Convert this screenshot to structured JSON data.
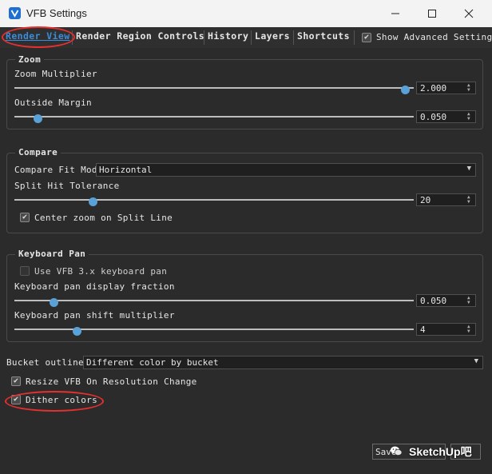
{
  "window": {
    "title": "VFB Settings"
  },
  "tabs": [
    {
      "label": "Render View"
    },
    {
      "label": "Render Region Controls"
    },
    {
      "label": "History"
    },
    {
      "label": "Layers"
    },
    {
      "label": "Shortcuts"
    }
  ],
  "show_advanced": {
    "label": "Show Advanced Settings",
    "checked": true
  },
  "zoom": {
    "title": "Zoom",
    "multiplier": {
      "label": "Zoom Multiplier",
      "value": "2.000",
      "fraction": 0.99
    },
    "outside_margin": {
      "label": "Outside Margin",
      "value": "0.050",
      "fraction": 0.05
    }
  },
  "compare": {
    "title": "Compare",
    "fit_mode": {
      "label": "Compare Fit Mode",
      "value": "Horizontal"
    },
    "split_hit": {
      "label": "Split Hit Tolerance",
      "value": "20",
      "fraction": 0.19
    },
    "center_zoom": {
      "label": "Center zoom on Split Line",
      "checked": true
    }
  },
  "keyboard_pan": {
    "title": "Keyboard Pan",
    "use_vfb3": {
      "label": "Use VFB 3.x keyboard pan",
      "checked": false
    },
    "display_fraction": {
      "label": "Keyboard pan display fraction",
      "value": "0.050",
      "fraction": 0.09
    },
    "shift_multiplier": {
      "label": "Keyboard pan shift multiplier",
      "value": "4",
      "fraction": 0.15
    }
  },
  "bucket_outlines": {
    "label": "Bucket outlines",
    "value": "Different color by bucket"
  },
  "resize_vfb": {
    "label": "Resize VFB On Resolution Change",
    "checked": true
  },
  "dither_colors": {
    "label": "Dither colors",
    "checked": true
  },
  "footer": {
    "save_label": "Save",
    "watermark": "SketchUp吧"
  },
  "colors": {
    "accent": "#3a8ddd",
    "knob": "#5aa1d8",
    "annotation": "#e53030"
  }
}
